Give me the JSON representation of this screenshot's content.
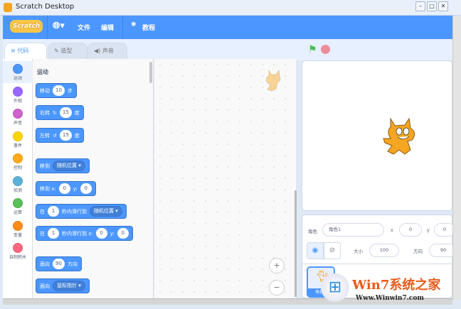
{
  "window": {
    "title": "Scratch Desktop",
    "minimize": "–",
    "maximize": "□",
    "close": "✕"
  },
  "menu": {
    "logo": "Scratch",
    "language_icon": "globe-icon",
    "file": "文件",
    "edit": "编辑",
    "tutorials": "教程"
  },
  "tabs": [
    {
      "label": "代码",
      "icon": "code-icon"
    },
    {
      "label": "造型",
      "icon": "brush-icon"
    },
    {
      "label": "声音",
      "icon": "speaker-icon"
    }
  ],
  "categories": [
    {
      "label": "运动",
      "color": "#4c97ff"
    },
    {
      "label": "外观",
      "color": "#9966ff"
    },
    {
      "label": "声音",
      "color": "#cf63cf"
    },
    {
      "label": "事件",
      "color": "#ffd500"
    },
    {
      "label": "控制",
      "color": "#ffab19"
    },
    {
      "label": "侦测",
      "color": "#5cb1d6"
    },
    {
      "label": "运算",
      "color": "#59c059"
    },
    {
      "label": "变量",
      "color": "#ff8c1a"
    },
    {
      "label": "自制积木",
      "color": "#ff6680"
    }
  ],
  "palette": {
    "section_title": "运动",
    "blocks": [
      [
        {
          "t": "text",
          "v": "移动"
        },
        {
          "t": "num",
          "v": "10"
        },
        {
          "t": "text",
          "v": "步"
        }
      ],
      [
        {
          "t": "text",
          "v": "右转"
        },
        {
          "t": "text",
          "v": "↻"
        },
        {
          "t": "num",
          "v": "15"
        },
        {
          "t": "text",
          "v": "度"
        }
      ],
      [
        {
          "t": "text",
          "v": "左转"
        },
        {
          "t": "text",
          "v": "↺"
        },
        {
          "t": "num",
          "v": "15"
        },
        {
          "t": "text",
          "v": "度"
        }
      ],
      [
        {
          "t": "text",
          "v": "移到"
        },
        {
          "t": "dd",
          "v": "随机位置 ▾"
        }
      ],
      [
        {
          "t": "text",
          "v": "移到 x:"
        },
        {
          "t": "num",
          "v": "0"
        },
        {
          "t": "text",
          "v": "y:"
        },
        {
          "t": "num",
          "v": "0"
        }
      ],
      [
        {
          "t": "text",
          "v": "在"
        },
        {
          "t": "num",
          "v": "1"
        },
        {
          "t": "text",
          "v": "秒内滑行到"
        },
        {
          "t": "dd",
          "v": "随机位置 ▾"
        }
      ],
      [
        {
          "t": "text",
          "v": "在"
        },
        {
          "t": "num",
          "v": "1"
        },
        {
          "t": "text",
          "v": "秒内滑行到 x:"
        },
        {
          "t": "num",
          "v": "0"
        },
        {
          "t": "text",
          "v": "y:"
        },
        {
          "t": "num",
          "v": "0"
        }
      ],
      [
        {
          "t": "text",
          "v": "面向"
        },
        {
          "t": "num",
          "v": "90"
        },
        {
          "t": "text",
          "v": "方向"
        }
      ],
      [
        {
          "t": "text",
          "v": "面向"
        },
        {
          "t": "dd",
          "v": "鼠标指针 ▾"
        }
      ]
    ]
  },
  "code_area": {
    "zoom_in": "+",
    "zoom_out": "−"
  },
  "sprite_info": {
    "sprite_label": "角色",
    "sprite_name": "角色1",
    "x_label": "x",
    "x": "0",
    "y_label": "y",
    "y": "0",
    "size_label": "大小",
    "size": "100",
    "direction_label": "方向",
    "direction": "90",
    "thumb_label": "角色1"
  },
  "watermark": {
    "text": "Win7系统之家",
    "url": "Www.Winwin7.com"
  }
}
